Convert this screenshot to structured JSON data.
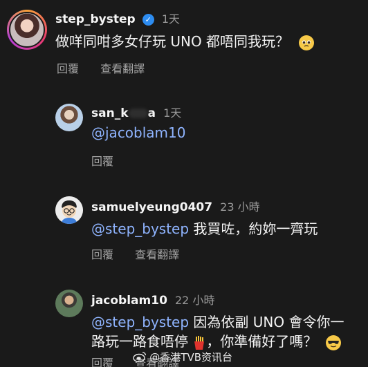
{
  "comments": [
    {
      "username": "step_bystep",
      "verified": true,
      "time": "1天",
      "text": "做咩同咁多女仔玩 UNO 都唔同我玩？",
      "emoji": "pleading-face",
      "reply_label": "回覆",
      "translate_label": "查看翻譯"
    },
    {
      "username_prefix": "san_k",
      "username_suffix": "a",
      "time": "1天",
      "mention": "@jacoblam10",
      "reply_label": "回覆"
    },
    {
      "username": "samuelyeung0407",
      "time": "23 小時",
      "mention": "@step_bystep",
      "text": " 我買咗，約妳一齊玩",
      "reply_label": "回覆",
      "translate_label": "查看翻譯"
    },
    {
      "username": "jacoblam10",
      "time": "22 小時",
      "mention": "@step_bystep",
      "text_line1": " 因為依副 UNO 會令你一",
      "text_line2a": "路玩一路食唔停",
      "text_line2b": "，你準備好了嗎？",
      "emoji1": "fries",
      "emoji2": "sunglasses-face",
      "reply_label": "回覆",
      "translate_label": "查看翻譯"
    }
  ],
  "watermark": {
    "text": "@香港TVB资讯台",
    "icon": "weibo-icon"
  }
}
